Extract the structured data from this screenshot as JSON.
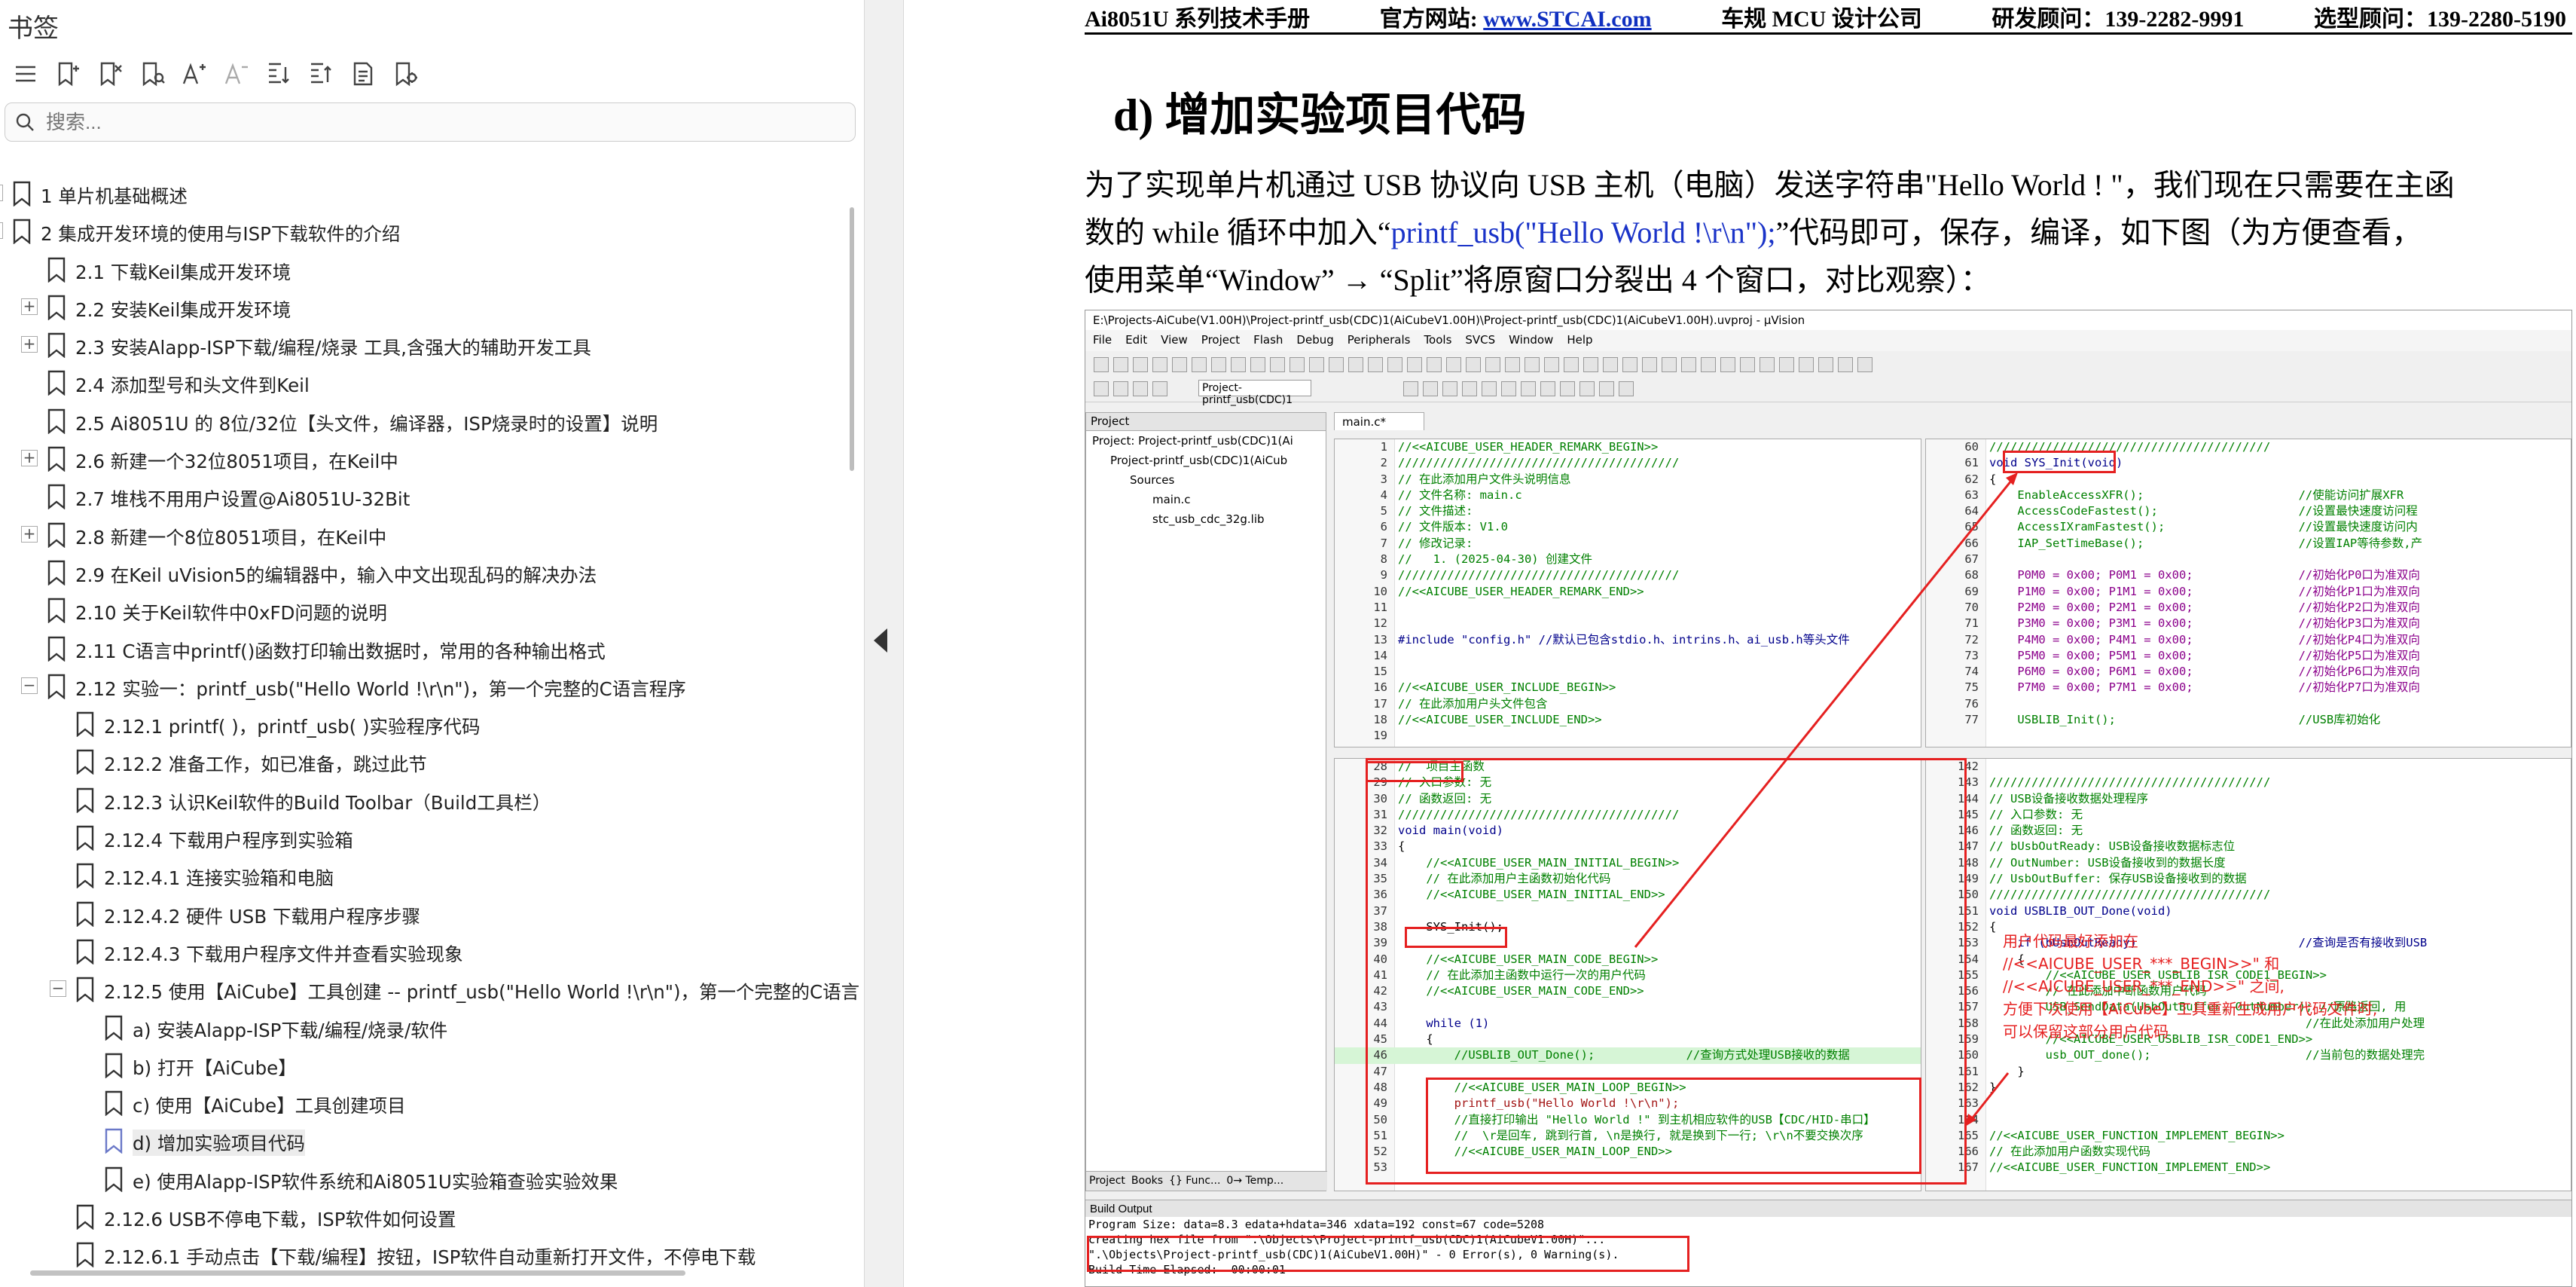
{
  "sidebar": {
    "title": "书签",
    "search_placeholder": "搜索...",
    "items": [
      {
        "label": "1 单片机基础概述",
        "level": 0,
        "toggle": "+"
      },
      {
        "label": "2 集成开发环境的使用与ISP下载软件的介绍",
        "level": 0,
        "toggle": "−"
      },
      {
        "label": "2.1 下载Keil集成开发环境",
        "level": 1,
        "toggle": ""
      },
      {
        "label": "2.2 安装Keil集成开发环境",
        "level": 1,
        "toggle": "+"
      },
      {
        "label": "2.3 安装Alapp-ISP下载/编程/烧录 工具,含强大的辅助开发工具",
        "level": 1,
        "toggle": "+"
      },
      {
        "label": "2.4 添加型号和头文件到Keil",
        "level": 1,
        "toggle": ""
      },
      {
        "label": "2.5 Ai8051U 的 8位/32位【头文件，编译器，ISP烧录时的设置】说明",
        "level": 1,
        "toggle": ""
      },
      {
        "label": "2.6 新建一个32位8051项目，在Keil中",
        "level": 1,
        "toggle": "+"
      },
      {
        "label": "2.7 堆栈不用用户设置@Ai8051U-32Bit",
        "level": 1,
        "toggle": ""
      },
      {
        "label": "2.8 新建一个8位8051项目，在Keil中",
        "level": 1,
        "toggle": "+"
      },
      {
        "label": "2.9 在Keil uVision5的编辑器中，输入中文出现乱码的解决办法",
        "level": 1,
        "toggle": ""
      },
      {
        "label": "2.10 关于Keil软件中0xFD问题的说明",
        "level": 1,
        "toggle": ""
      },
      {
        "label": "2.11 C语言中printf()函数打印输出数据时，常用的各种输出格式",
        "level": 1,
        "toggle": ""
      },
      {
        "label": "2.12 实验一：printf_usb(\"Hello World !\\r\\n\")，第一个完整的C语言程序",
        "level": 1,
        "toggle": "−"
      },
      {
        "label": "2.12.1 printf( )，printf_usb( )实验程序代码",
        "level": 2,
        "toggle": ""
      },
      {
        "label": "2.12.2 准备工作，如已准备，跳过此节",
        "level": 2,
        "toggle": ""
      },
      {
        "label": "2.12.3 认识Keil软件的Build Toolbar（Build工具栏）",
        "level": 2,
        "toggle": ""
      },
      {
        "label": "2.12.4 下载用户程序到实验箱",
        "level": 2,
        "toggle": ""
      },
      {
        "label": "2.12.4.1 连接实验箱和电脑",
        "level": 2,
        "toggle": ""
      },
      {
        "label": "2.12.4.2 硬件 USB 下载用户程序步骤",
        "level": 2,
        "toggle": ""
      },
      {
        "label": "2.12.4.3 下载用户程序文件并查看实验现象",
        "level": 2,
        "toggle": ""
      },
      {
        "label": "2.12.5 使用【AiCube】工具创建 -- printf_usb(\"Hello World !\\r\\n\")，第一个完整的C语言",
        "level": 2,
        "toggle": "−"
      },
      {
        "label": "a) 安装Alapp-ISP下载/编程/烧录/软件",
        "level": 3,
        "toggle": ""
      },
      {
        "label": "b) 打开【AiCube】",
        "level": 3,
        "toggle": ""
      },
      {
        "label": "c) 使用【AiCube】工具创建项目",
        "level": 3,
        "toggle": ""
      },
      {
        "label": "d) 增加实验项目代码",
        "level": 3,
        "toggle": "",
        "selected": true
      },
      {
        "label": "e) 使用Alapp-ISP软件系统和Ai8051U实验箱查验实验效果",
        "level": 3,
        "toggle": ""
      },
      {
        "label": "2.12.6 USB不停电下载，ISP软件如何设置",
        "level": 2,
        "toggle": ""
      },
      {
        "label": "2.12.6.1 手动点击【下载/编程】按钮，ISP软件自动重新打开文件，不停电下载",
        "level": 2,
        "toggle": ""
      }
    ]
  },
  "header": {
    "product": "Ai8051U 系列技术手册",
    "site_label": "官方网站:",
    "site": "www.STCAI.com",
    "company": "车规 MCU 设计公司",
    "rd": "研发顾问：139-2282-9991",
    "sel": "选型顾问：139-2280-5190"
  },
  "section": {
    "heading": "d) 增加实验项目代码",
    "p1": "为了实现单片机通过 USB 协议向 USB 主机（电脑）发送字符串\"Hello World ! \"，我们现在只需要在主函",
    "p2a": "数的 while 循环中加入“",
    "p2code": "printf_usb(\"Hello World !\\r\\n\");",
    "p2b": "”代码即可，保存，编译，如下图（为方便查看，",
    "p3": "使用菜单“Window” → “Split”将原窗口分裂出 4 个窗口，对比观察）："
  },
  "ide": {
    "title": "E:\\Projects-AiCube(V1.00H)\\Project-printf_usb(CDC)1(AiCubeV1.00H)\\Project-printf_usb(CDC)1(AiCubeV1.00H).uvproj - µVision",
    "menus": [
      "File",
      "Edit",
      "View",
      "Project",
      "Flash",
      "Debug",
      "Peripherals",
      "Tools",
      "SVCS",
      "Window",
      "Help"
    ],
    "target": "Project-printf_usb(CDC)1",
    "project_title": "Project",
    "tree": [
      "Project: Project-printf_usb(CDC)1(Ai",
      "Project-printf_usb(CDC)1(AiCub",
      "Sources",
      "main.c",
      "stc_usb_cdc_32g.lib"
    ],
    "project_tabs": [
      "Project",
      "Books",
      "{} Func...",
      "0→ Temp..."
    ],
    "tab": "main.c*",
    "pane1": [
      [
        "1",
        "//<<AICUBE_USER_HEADER_REMARK_BEGIN>>",
        "g"
      ],
      [
        "2",
        "////////////////////////////////////////",
        "g"
      ],
      [
        "3",
        "// 在此添加用户文件头说明信息",
        "g"
      ],
      [
        "4",
        "// 文件名称: main.c",
        "g"
      ],
      [
        "5",
        "// 文件描述:",
        "g"
      ],
      [
        "6",
        "// 文件版本: V1.0",
        "g"
      ],
      [
        "7",
        "// 修改记录:",
        "g"
      ],
      [
        "8",
        "//   1. (2025-04-30) 创建文件",
        "g"
      ],
      [
        "9",
        "////////////////////////////////////////",
        "g"
      ],
      [
        "10",
        "//<<AICUBE_USER_HEADER_REMARK_END>>",
        "g"
      ],
      [
        "11",
        "",
        ""
      ],
      [
        "12",
        "",
        ""
      ],
      [
        "13",
        "#include \"config.h\" //默认已包含stdio.h、intrins.h、ai_usb.h等头文件",
        "k"
      ],
      [
        "14",
        "",
        ""
      ],
      [
        "15",
        "",
        ""
      ],
      [
        "16",
        "//<<AICUBE_USER_INCLUDE_BEGIN>>",
        "g"
      ],
      [
        "17",
        "// 在此添加用户头文件包含",
        "g"
      ],
      [
        "18",
        "//<<AICUBE_USER_INCLUDE_END>>",
        "g"
      ],
      [
        "19",
        "",
        ""
      ]
    ],
    "pane2": [
      [
        "60",
        "////////////////////////////////////////",
        "g"
      ],
      [
        "61",
        "void SYS_Init(void)",
        "k"
      ],
      [
        "62",
        "{",
        ""
      ],
      [
        "63",
        "    EnableAccessXFR();                      //使能访问扩展XFR",
        "g"
      ],
      [
        "64",
        "    AccessCodeFastest();                    //设置最快速度访问程",
        "g"
      ],
      [
        "65",
        "    AccessIXramFastest();                   //设置最快速度访问内",
        "g"
      ],
      [
        "66",
        "    IAP_SetTimeBase();                      //设置IAP等待参数,产",
        "g"
      ],
      [
        "67",
        "",
        ""
      ],
      [
        "68",
        "    P0M0 = 0x00; P0M1 = 0x00;               //初始化P0口为准双向",
        "n"
      ],
      [
        "69",
        "    P1M0 = 0x00; P1M1 = 0x00;               //初始化P1口为准双向",
        "n"
      ],
      [
        "70",
        "    P2M0 = 0x00; P2M1 = 0x00;               //初始化P2口为准双向",
        "n"
      ],
      [
        "71",
        "    P3M0 = 0x00; P3M1 = 0x00;               //初始化P3口为准双向",
        "n"
      ],
      [
        "72",
        "    P4M0 = 0x00; P4M1 = 0x00;               //初始化P4口为准双向",
        "n"
      ],
      [
        "73",
        "    P5M0 = 0x00; P5M1 = 0x00;               //初始化P5口为准双向",
        "n"
      ],
      [
        "74",
        "    P6M0 = 0x00; P6M1 = 0x00;               //初始化P6口为准双向",
        "n"
      ],
      [
        "75",
        "    P7M0 = 0x00; P7M1 = 0x00;               //初始化P7口为准双向",
        "n"
      ],
      [
        "76",
        "",
        ""
      ],
      [
        "77",
        "    USBLIB_Init();                          //USB库初始化",
        "g"
      ]
    ],
    "pane3": [
      [
        "28",
        "//  项目主函数",
        "g"
      ],
      [
        "29",
        "// 入口参数: 无",
        "g"
      ],
      [
        "30",
        "// 函数返回: 无",
        "g"
      ],
      [
        "31",
        "////////////////////////////////////////",
        "g"
      ],
      [
        "32",
        "void main(void)",
        "k"
      ],
      [
        "33",
        "{",
        ""
      ],
      [
        "34",
        "    //<<AICUBE_USER_MAIN_INITIAL_BEGIN>>",
        "g"
      ],
      [
        "35",
        "    // 在此添加用户主函数初始化代码",
        "g"
      ],
      [
        "36",
        "    //<<AICUBE_USER_MAIN_INITIAL_END>>",
        "g"
      ],
      [
        "37",
        "",
        ""
      ],
      [
        "38",
        "    SYS_Init();",
        ""
      ],
      [
        "39",
        "",
        ""
      ],
      [
        "40",
        "    //<<AICUBE_USER_MAIN_CODE_BEGIN>>",
        "g"
      ],
      [
        "41",
        "    // 在此添加主函数中运行一次的用户代码",
        "g"
      ],
      [
        "42",
        "    //<<AICUBE_USER_MAIN_CODE_END>>",
        "g"
      ],
      [
        "43",
        "",
        ""
      ],
      [
        "44",
        "    while (1)",
        "k"
      ],
      [
        "45",
        "    {",
        ""
      ],
      [
        "46",
        "        //USBLIB_OUT_Done();             //查询方式处理USB接收的数据",
        "g"
      ],
      [
        "47",
        "",
        ""
      ],
      [
        "48",
        "        //<<AICUBE_USER_MAIN_LOOP_BEGIN>>",
        "g"
      ],
      [
        "49",
        "        printf_usb(\"Hello World !\\r\\n\");",
        "s"
      ],
      [
        "50",
        "        //直接打印输出 \"Hello World !\" 到主机相应软件的USB【CDC/HID-串口】",
        "g"
      ],
      [
        "51",
        "        //  \\r是回车, 跳到行首, \\n是换行, 就是换到下一行; \\r\\n不要交换次序",
        "g"
      ],
      [
        "52",
        "        //<<AICUBE_USER_MAIN_LOOP_END>>",
        "g"
      ],
      [
        "53",
        "",
        ""
      ]
    ],
    "pane4": [
      [
        "142",
        "",
        ""
      ],
      [
        "143",
        "////////////////////////////////////////",
        "g"
      ],
      [
        "144",
        "// USB设备接收数据处理程序",
        "g"
      ],
      [
        "145",
        "// 入口参数: 无",
        "g"
      ],
      [
        "146",
        "// 函数返回: 无",
        "g"
      ],
      [
        "147",
        "// bUsbOutReady: USB设备接收数据标志位",
        "g"
      ],
      [
        "148",
        "// OutNumber: USB设备接收到的数据长度",
        "g"
      ],
      [
        "149",
        "// UsbOutBuffer: 保存USB设备接收到的数据",
        "g"
      ],
      [
        "150",
        "////////////////////////////////////////",
        "g"
      ],
      [
        "151",
        "void USBLIB_OUT_Done(void)",
        "k"
      ],
      [
        "152",
        "{",
        ""
      ],
      [
        "153",
        "    if (bUsbOutReady)                       //查询是否有接收到USB",
        "k"
      ],
      [
        "154",
        "    {",
        ""
      ],
      [
        "155",
        "        //<<AICUBE_USER_USBLIB_ISR_CODE1_BEGIN>>",
        "g"
      ],
      [
        "156",
        "        // 在此添加中断函数用户代码",
        "g"
      ],
      [
        "157",
        "        USB_SendData(UsbOutBuffer, OutNumber); //原路返回, 用",
        "g"
      ],
      [
        "158",
        "                                             //在此处添加用户处理",
        "g"
      ],
      [
        "159",
        "        //<<AICUBE_USER_USBLIB_ISR_CODE1_END>>",
        "g"
      ],
      [
        "160",
        "        usb_OUT_done();                      //当前包的数据处理完",
        "g"
      ],
      [
        "161",
        "    }",
        ""
      ],
      [
        "162",
        "}",
        ""
      ],
      [
        "163",
        "",
        ""
      ],
      [
        "164",
        "",
        ""
      ],
      [
        "165",
        "//<<AICUBE_USER_FUNCTION_IMPLEMENT_BEGIN>>",
        "g"
      ],
      [
        "166",
        "// 在此添加用户函数实现代码",
        "g"
      ],
      [
        "167",
        "//<<AICUBE_USER_FUNCTION_IMPLEMENT_END>>",
        "g"
      ]
    ],
    "note": [
      "用户代码最好添加在",
      "//<<AICUBE_USER_***_BEGIN>>\" 和",
      "//<<AICUBE_USER_***_END>>\" 之间,",
      "方便下次使用【AiCube】工具重新生成用户代码文件时,",
      "可以保留这部分用户代码"
    ],
    "build_title": "Build Output",
    "build": [
      "Program Size: data=8.3 edata+hdata=346 xdata=192 const=67 code=5208",
      "creating hex file from \".\\Objects\\Project-printf_usb(CDC)1(AiCubeV1.00H)\"...",
      "\".\\Objects\\Project-printf_usb(CDC)1(AiCubeV1.00H)\" - 0 Error(s), 0 Warning(s).",
      "Build Time Elapsed:  00:00:01"
    ]
  },
  "colors": {
    "accent_red": "#e52020",
    "link_blue": "#1030c0",
    "code_blue": "#1a33c8"
  }
}
